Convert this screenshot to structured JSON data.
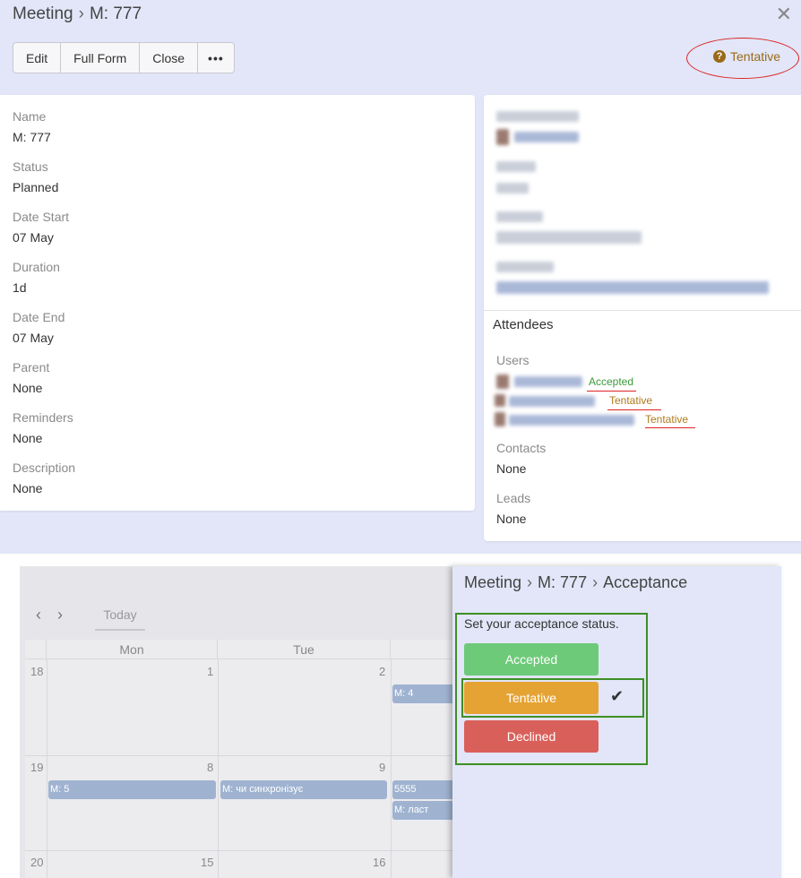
{
  "header": {
    "entity": "Meeting",
    "separator": "›",
    "record": "M: 777",
    "close_icon": "✕"
  },
  "toolbar": {
    "edit_label": "Edit",
    "full_form_label": "Full Form",
    "close_label": "Close",
    "more_label": "•••"
  },
  "acceptance_status": {
    "icon": "?",
    "label": "Tentative",
    "color": "#9a6a18"
  },
  "fields": [
    {
      "label": "Name",
      "value": "M: 777"
    },
    {
      "label": "Status",
      "value": "Planned"
    },
    {
      "label": "Date Start",
      "value": "07 May"
    },
    {
      "label": "Duration",
      "value": "1d"
    },
    {
      "label": "Date End",
      "value": "07 May"
    },
    {
      "label": "Parent",
      "value": "None"
    },
    {
      "label": "Reminders",
      "value": "None"
    },
    {
      "label": "Description",
      "value": "None"
    }
  ],
  "attendees": {
    "title": "Attendees",
    "users_label": "Users",
    "user_statuses": [
      "Accepted",
      "Tentative",
      "Tentative"
    ],
    "contacts_label": "Contacts",
    "contacts_value": "None",
    "leads_label": "Leads",
    "leads_value": "None"
  },
  "calendar": {
    "prev_icon": "‹",
    "next_icon": "›",
    "today_label": "Today",
    "day_headers": [
      "Mon",
      "Tue"
    ],
    "week_numbers": [
      "18",
      "19",
      "20"
    ],
    "day_numbers": {
      "row1": [
        "1",
        "2"
      ],
      "row2": [
        "8",
        "9"
      ],
      "row3": [
        "15",
        "16"
      ]
    },
    "events": {
      "m4": "M: 4",
      "m5": "M: 5",
      "sync": "M: чи синхронізує",
      "s5555": "5555",
      "last": "M: ласт"
    }
  },
  "acceptance_panel": {
    "entity": "Meeting",
    "record": "M: 777",
    "page": "Acceptance",
    "separator": "›",
    "prompt": "Set your acceptance status.",
    "accepted_label": "Accepted",
    "tentative_label": "Tentative",
    "declined_label": "Declined",
    "check_icon": "✔",
    "colors": {
      "accepted": "#6dca79",
      "tentative": "#e5a334",
      "declined": "#d9605a",
      "highlight": "#3e8e25"
    }
  }
}
